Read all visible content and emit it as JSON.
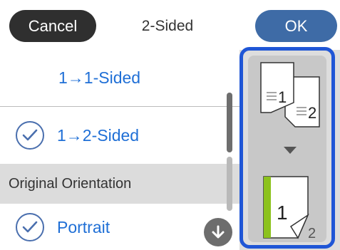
{
  "header": {
    "cancel_label": "Cancel",
    "title": "2-Sided",
    "ok_label": "OK"
  },
  "list": {
    "items": [
      {
        "label": "1→1-Sided",
        "selected": false
      },
      {
        "label": "1→2-Sided",
        "selected": true
      }
    ],
    "section_header": "Original Orientation",
    "orientation_item": {
      "label": "Portrait",
      "selected": true
    }
  },
  "preview": {
    "source_page_1": "1",
    "source_page_2": "2",
    "output_front": "1",
    "output_back": "2"
  },
  "colors": {
    "accent_blue": "#1f6fd6",
    "ok_button": "#3e6ba6",
    "selection_frame": "#1f56d6",
    "page_stripe": "#8cc21d"
  },
  "icons": [
    "check-icon",
    "scroll-down-icon",
    "arrow-down-icon"
  ]
}
